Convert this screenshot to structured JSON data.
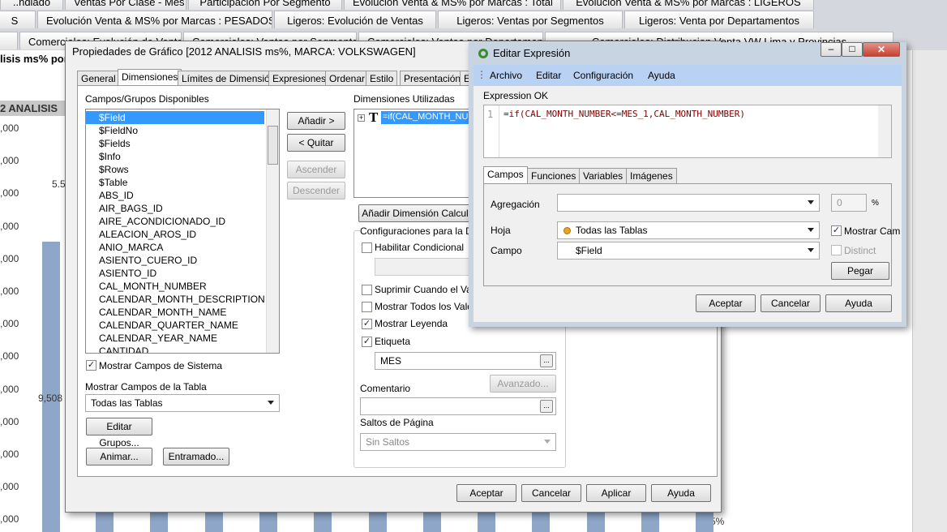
{
  "sheet_tabs": {
    "row1": [
      "..ndiado",
      "Ventas Por Clase - Mes",
      "Participación Por Segmento",
      "Evolución Venta & MS% por Marcas : Total",
      "Evolución Venta & MS% por Marcas : LIGEROS"
    ],
    "row2": [
      "S",
      "Evolución Venta & MS% por Marcas : PESADOS",
      "Ligeros: Evolución de Ventas",
      "Ligeros: Ventas por Segmentos",
      "Ligeros: Venta por Departamentos"
    ],
    "row3": [
      "",
      "Comerciales: Evolución de Ventas",
      "Comerciales: Ventas por Segmentos",
      "Comerciales: Ventas por Departamentos",
      "Comerciales: Distribucion Venta VW Lima y Provincias"
    ]
  },
  "background_chart": {
    "caption": "lisis ms% por $",
    "header": "2  ANALISIS",
    "axis_labels": [
      ",000",
      ",000",
      ",000",
      ",000",
      ",000",
      ",000",
      ",000",
      ",000",
      ",000",
      ",000",
      ",000",
      ",000",
      ",000"
    ],
    "label_top": "5.5",
    "label_bar": "9,508",
    "right_label": "0.5%",
    "bar_color": "#8ea7c8"
  },
  "props_dialog": {
    "title": "Propiedades de Gráfico [2012 ANALISIS  ms%, MARCA: VOLKSWAGEN]",
    "tabs": [
      "General",
      "Dimensiones",
      "Límites de Dimensión",
      "Expresiones",
      "Ordenar",
      "Estilo",
      "Presentación",
      "E"
    ],
    "active_tab": 1,
    "available_label": "Campos/Grupos Disponibles",
    "fields": [
      "$Field",
      "$FieldNo",
      "$Fields",
      "$Info",
      "$Rows",
      "$Table",
      "ABS_ID",
      "AIR_BAGS_ID",
      "AIRE_ACONDICIONADO_ID",
      "ALEACION_AROS_ID",
      "ANIO_MARCA",
      "ASIENTO_CUERO_ID",
      "ASIENTO_ID",
      "CAL_MONTH_NUMBER",
      "CALENDAR_MONTH_DESCRIPTION",
      "CALENDAR_MONTH_NAME",
      "CALENDAR_QUARTER_NAME",
      "CALENDAR_YEAR_NAME",
      "CANTIDAD"
    ],
    "selected_field": 0,
    "add": "Añadir >",
    "remove": "< Quitar",
    "up": "Ascender",
    "down": "Descender",
    "used_label": "Dimensiones Utilizadas",
    "used_item": "=if(CAL_MONTH_NUMBER",
    "add_calc": "Añadir Dimensión Calculada",
    "settings_label": "Configuraciones para la Dime",
    "cond": "Habilitar Condicional",
    "suppress": "Suprimir Cuando el Valor",
    "show_all": "Mostrar Todos los Valores",
    "legend": "Mostrar Leyenda",
    "label": "Etiqueta",
    "label_value": "MES",
    "advanced": "Avanzado...",
    "comment": "Comentario",
    "page_breaks": "Saltos de Página",
    "page_breaks_value": "Sin Saltos",
    "show_system": "Mostrar Campos de Sistema",
    "show_table_label": "Mostrar Campos de la Tabla",
    "table_value": "Todas las Tablas",
    "edit_groups": "Editar Grupos...",
    "animate": "Animar...",
    "trellis": "Entramado...",
    "ok": "Aceptar",
    "cancel": "Cancelar",
    "apply": "Aplicar",
    "help": "Ayuda"
  },
  "expr_dialog": {
    "title": "Editar Expresión",
    "menu": [
      "Archivo",
      "Editar",
      "Configuración",
      "Ayuda"
    ],
    "status": "Expression OK",
    "line_no": "1",
    "code": "=if(CAL_MONTH_NUMBER<=MES_1,CAL_MONTH_NUMBER)",
    "tabs": [
      "Campos",
      "Funciones",
      "Variables",
      "Imágenes"
    ],
    "agg_label": "Agregación",
    "agg_value": "",
    "pct_value": "0",
    "pct": "%",
    "sheet_label": "Hoja",
    "sheet_value": "Todas las Tablas",
    "field_label": "Campo",
    "field_value": "$Field",
    "show_fields": "Mostrar Cam",
    "distinct": "Distinct",
    "paste": "Pegar",
    "ok": "Aceptar",
    "cancel": "Cancelar",
    "help": "Ayuda",
    "menu_color": "#b9d1f3"
  }
}
